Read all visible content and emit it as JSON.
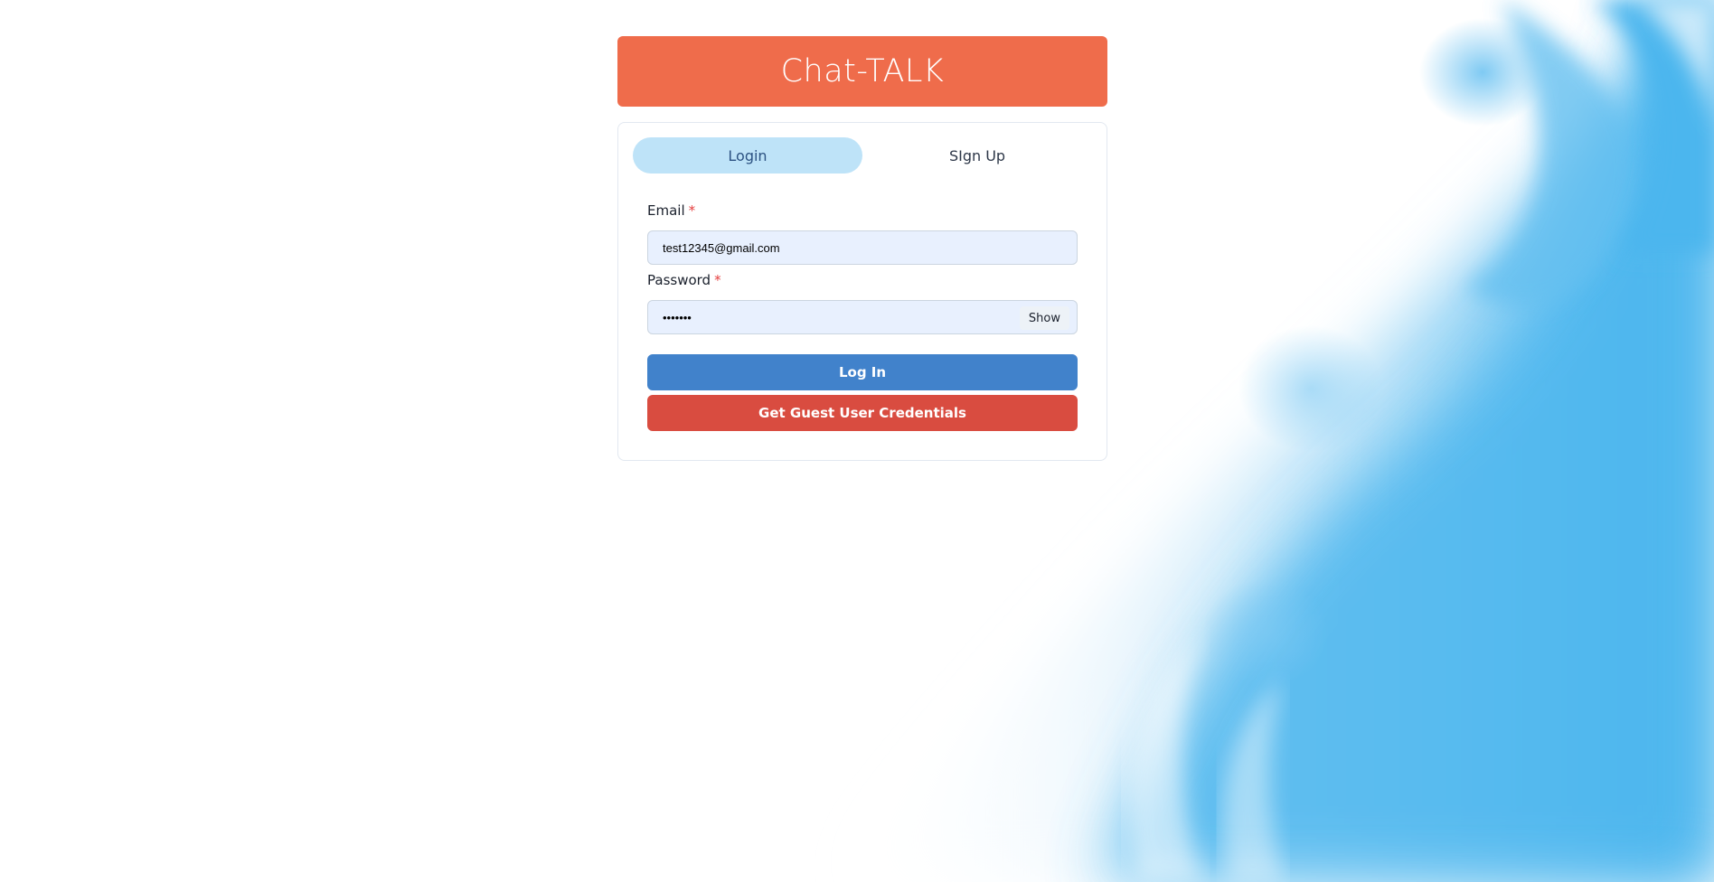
{
  "app": {
    "title": "Chat-TALK"
  },
  "tabs": [
    {
      "label": "Login",
      "active": true
    },
    {
      "label": "SIgn Up",
      "active": false
    }
  ],
  "form": {
    "email": {
      "label": "Email",
      "required_mark": "*",
      "value": "test12345@gmail.com"
    },
    "password": {
      "label": "Password",
      "required_mark": "*",
      "value": "•••••••",
      "toggle_label": "Show"
    },
    "login_button": "Log In",
    "guest_button": "Get Guest User Credentials"
  },
  "colors": {
    "title_bg": "#ef6c4b",
    "login_button": "#4182cb",
    "guest_button": "#d94c40",
    "tab_active_bg": "#bee3f8",
    "background_accent": "#4bb6ee"
  }
}
